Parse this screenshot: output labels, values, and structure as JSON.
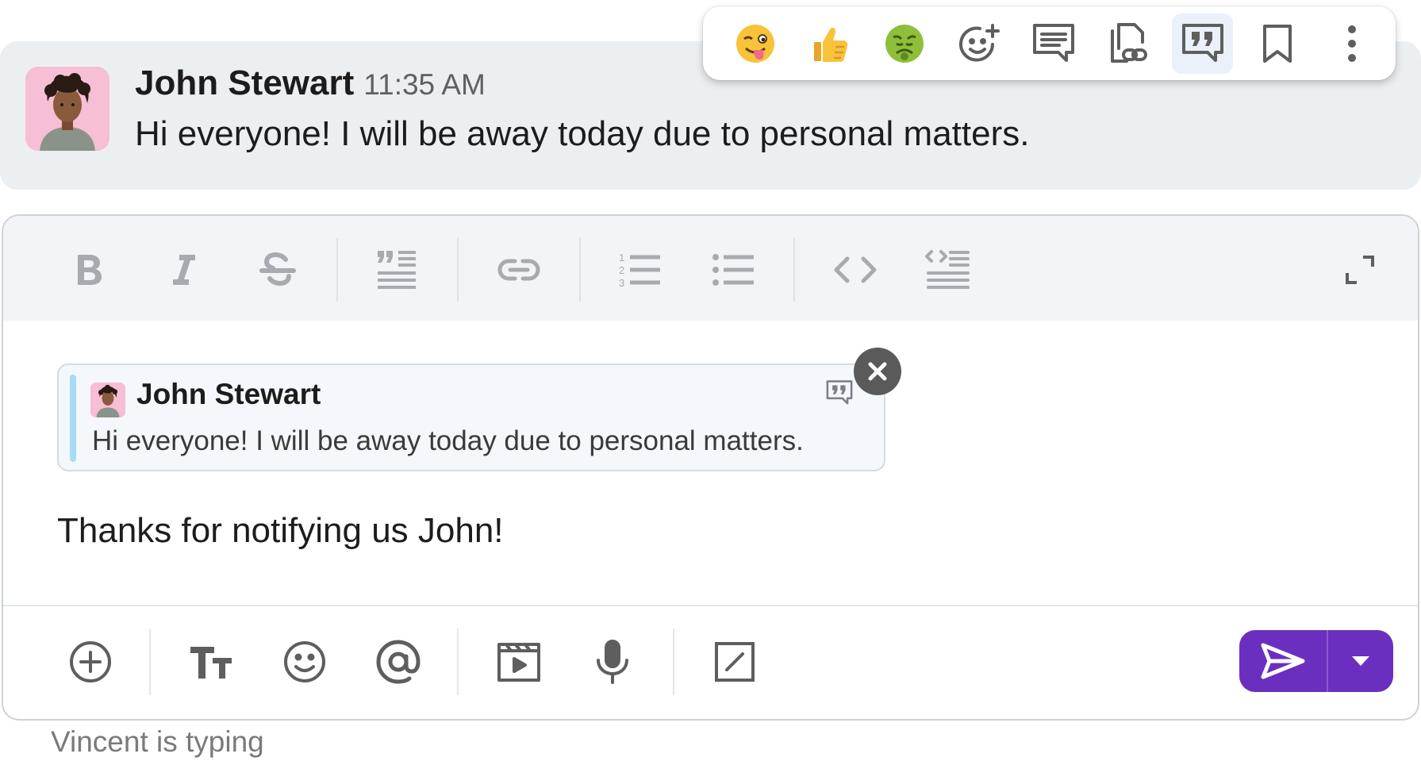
{
  "message": {
    "author": "John Stewart",
    "time": "11:35 AM",
    "text": "Hi everyone! I will be away today due to personal matters."
  },
  "actions": [
    {
      "name": "winking-tongue-emoji",
      "label": "😜"
    },
    {
      "name": "thumbs-up-emoji",
      "label": "👍"
    },
    {
      "name": "sick-face-emoji",
      "label": "🤢"
    },
    {
      "name": "add-reaction-icon"
    },
    {
      "name": "reply-in-thread-icon"
    },
    {
      "name": "copy-link-icon"
    },
    {
      "name": "quote-icon"
    },
    {
      "name": "bookmark-icon"
    },
    {
      "name": "more-options-icon"
    }
  ],
  "composer": {
    "quote": {
      "author": "John Stewart",
      "text": "Hi everyone! I will be away today due to personal matters."
    },
    "reply_text": "Thanks for notifying us John!"
  },
  "status": {
    "typing": "Vincent is typing"
  },
  "colors": {
    "accent": "#6b2fbf",
    "message_bg": "#eceff2",
    "toolbar_bg": "#f2f4f7",
    "quote_bar": "#a7dcf5"
  }
}
